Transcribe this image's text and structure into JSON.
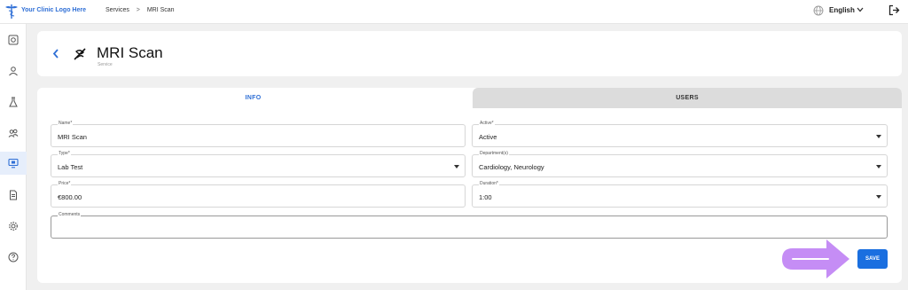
{
  "topbar": {
    "logo_text": "Your Clinic Logo Here",
    "breadcrumb": [
      "Services",
      "MRI Scan"
    ],
    "breadcrumb_sep": ">",
    "language": "English"
  },
  "sidebar": {
    "items": [
      {
        "icon": "dashboard-icon"
      },
      {
        "icon": "user-icon"
      },
      {
        "icon": "lab-flask-icon"
      },
      {
        "icon": "group-icon"
      },
      {
        "icon": "services-monitor-icon",
        "active": true
      },
      {
        "icon": "document-icon"
      },
      {
        "icon": "settings-icon"
      },
      {
        "icon": "help-icon"
      }
    ]
  },
  "header": {
    "title": "MRI Scan",
    "subtitle": "Service"
  },
  "tabs": {
    "info": "INFO",
    "users": "USERS"
  },
  "form": {
    "name": {
      "label": "Name*",
      "value": "MRI Scan"
    },
    "active": {
      "label": "Active*",
      "value": "Active"
    },
    "type": {
      "label": "Type*",
      "value": "Lab Test"
    },
    "departments": {
      "label": "Department(s)",
      "value": "Cardiology, Neurology"
    },
    "price": {
      "label": "Price*",
      "value": "€800.00"
    },
    "duration": {
      "label": "Duration*",
      "value": "1:00"
    },
    "comments": {
      "label": "Comments",
      "value": ""
    }
  },
  "actions": {
    "save_label": "SAVE"
  },
  "colors": {
    "accent": "#1a6fe0",
    "hint_arrow": "#c58df5"
  }
}
